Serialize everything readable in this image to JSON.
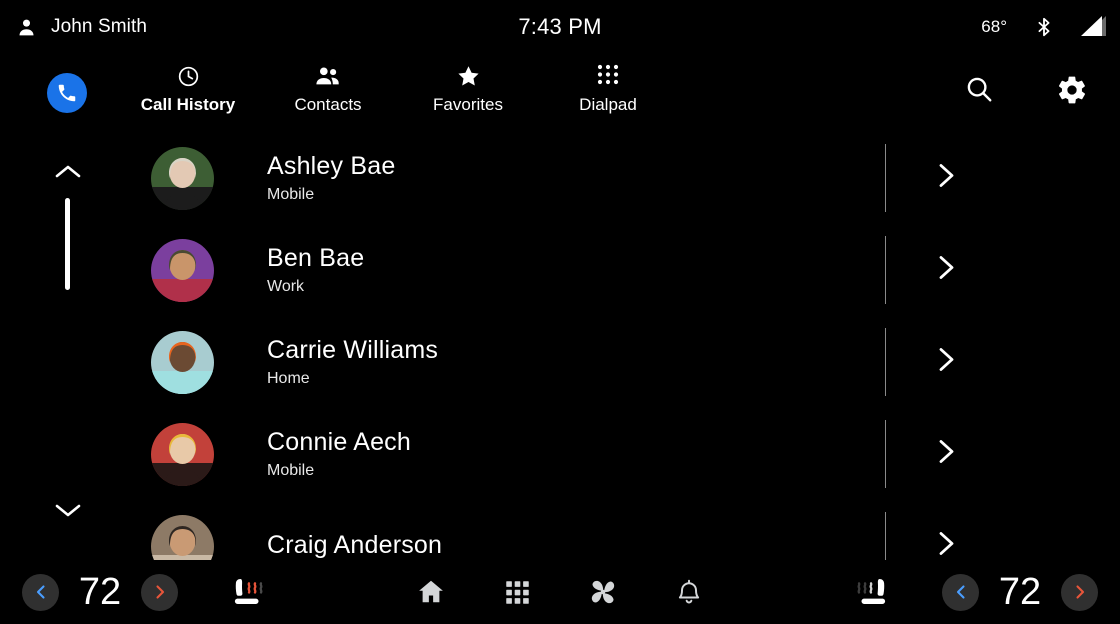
{
  "statusbar": {
    "user_icon": "person-icon",
    "user_name": "John Smith",
    "clock": "7:43 PM",
    "temperature": "68°",
    "bluetooth_icon": "bluetooth-icon",
    "signal_icon": "signal-bars-icon"
  },
  "appbar": {
    "app_icon": "phone-icon",
    "app_accent_color": "#1a73e8",
    "tabs": [
      {
        "label": "Call History",
        "icon": "clock-icon",
        "active": true
      },
      {
        "label": "Contacts",
        "icon": "people-icon",
        "active": false
      },
      {
        "label": "Favorites",
        "icon": "star-icon",
        "active": false
      },
      {
        "label": "Dialpad",
        "icon": "dialpad-icon",
        "active": false
      }
    ],
    "search_icon": "search-icon",
    "settings_icon": "gear-icon"
  },
  "list": {
    "scroll_up_icon": "chevron-up-icon",
    "scroll_down_icon": "chevron-down-icon",
    "row_chevron_icon": "chevron-right-icon",
    "contacts": [
      {
        "name": "Ashley Bae",
        "label": "Mobile"
      },
      {
        "name": "Ben Bae",
        "label": "Work"
      },
      {
        "name": "Carrie Williams",
        "label": "Home"
      },
      {
        "name": "Connie Aech",
        "label": "Mobile"
      },
      {
        "name": "Craig Anderson",
        "label": ""
      }
    ]
  },
  "bottombar": {
    "left_climate": {
      "decrease_icon": "chevron-left-icon",
      "decrease_color": "#4a9eff",
      "temperature": "72",
      "increase_icon": "chevron-right-icon",
      "increase_color": "#e8553a"
    },
    "right_climate": {
      "decrease_icon": "chevron-left-icon",
      "decrease_color": "#4a9eff",
      "temperature": "72",
      "increase_icon": "chevron-right-icon",
      "increase_color": "#e8553a"
    },
    "left_seat_icon": "heated-seat-on-icon",
    "right_seat_icon": "heated-seat-off-icon",
    "nav": [
      {
        "icon": "home-icon"
      },
      {
        "icon": "apps-grid-icon"
      },
      {
        "icon": "fan-icon"
      },
      {
        "icon": "bell-icon"
      }
    ]
  }
}
